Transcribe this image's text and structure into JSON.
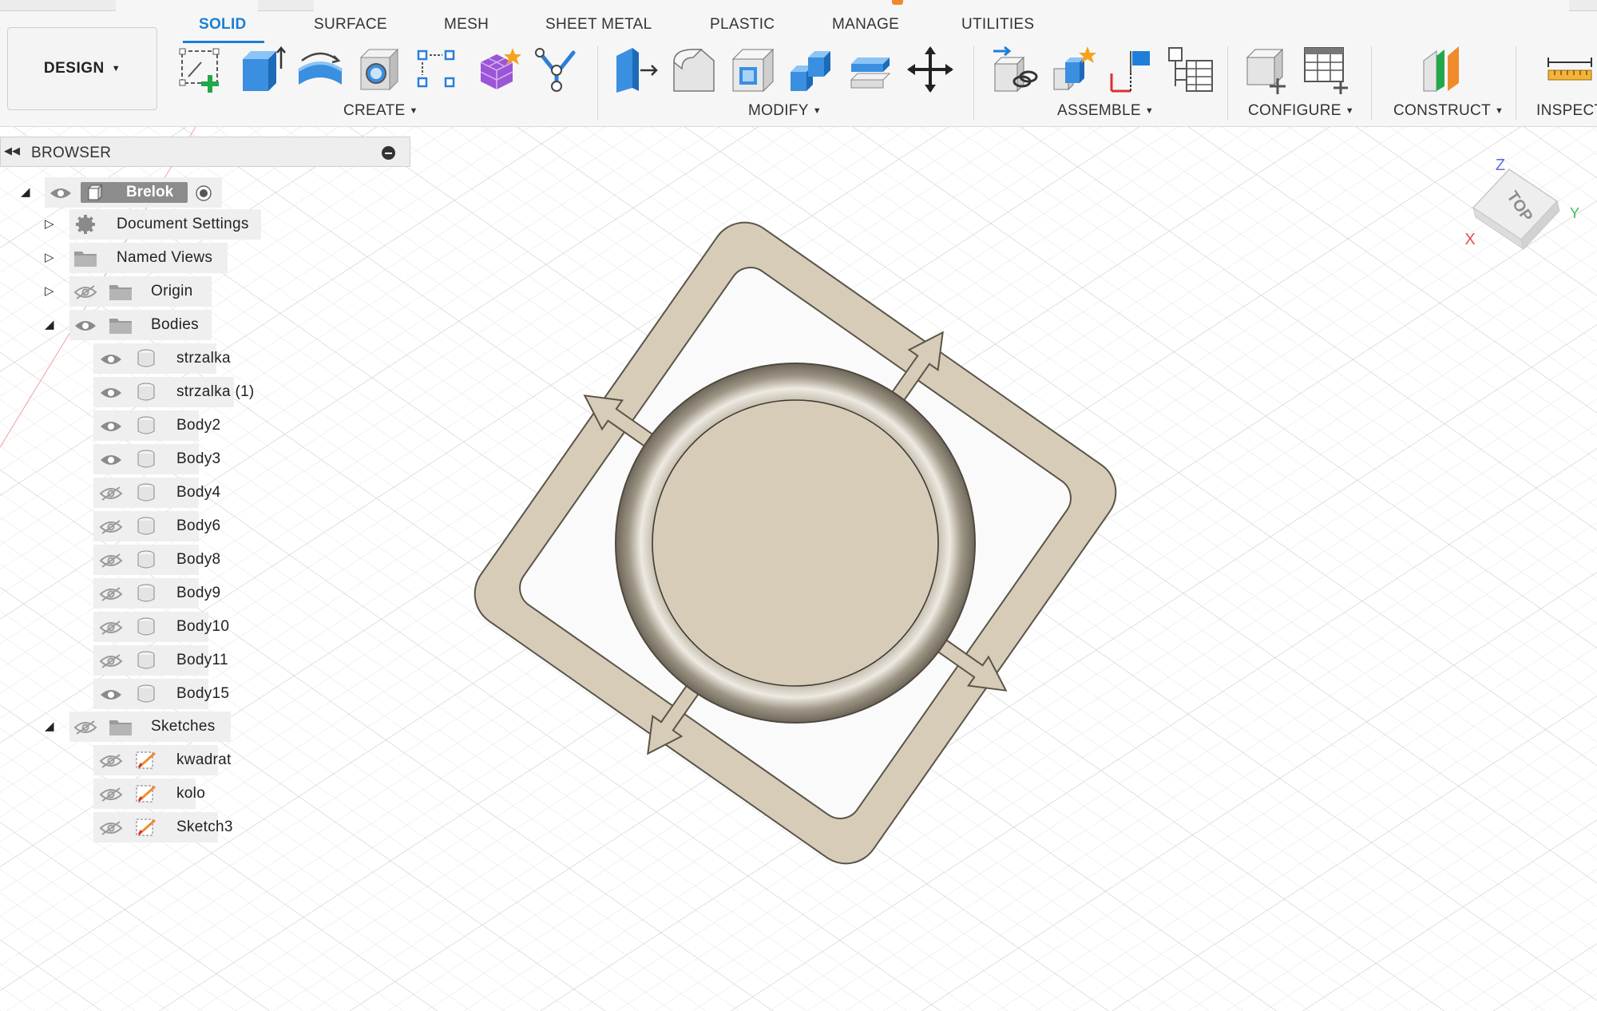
{
  "toolbar": {
    "workspace_label": "DESIGN",
    "tabs": [
      {
        "label": "SOLID",
        "active": true
      },
      {
        "label": "SURFACE"
      },
      {
        "label": "MESH"
      },
      {
        "label": "SHEET METAL"
      },
      {
        "label": "PLASTIC"
      },
      {
        "label": "MANAGE"
      },
      {
        "label": "UTILITIES"
      }
    ],
    "groups": [
      {
        "label": "CREATE",
        "tools": [
          "create-sketch-icon",
          "extrude-icon",
          "revolve-icon",
          "hole-icon",
          "pattern-icon",
          "form-icon",
          "derive-icon"
        ]
      },
      {
        "label": "MODIFY",
        "tools": [
          "press-pull-icon",
          "fillet-icon",
          "shell-icon",
          "combine-icon",
          "offset-face-icon",
          "move-icon"
        ]
      },
      {
        "label": "ASSEMBLE",
        "tools": [
          "new-component-icon",
          "joint-icon",
          "joint-origin-icon",
          "as-built-joint-icon"
        ]
      },
      {
        "label": "CONFIGURE",
        "tools": [
          "change-parameters-icon",
          "configuration-table-icon"
        ]
      },
      {
        "label": "CONSTRUCT",
        "tools": [
          "offset-plane-icon"
        ]
      },
      {
        "label": "INSPECT",
        "tools": [
          "measure-icon"
        ]
      }
    ],
    "accent_color": "#1a7fd6"
  },
  "browser": {
    "title": "BROWSER",
    "root": {
      "label": "Brelok"
    },
    "items": [
      {
        "label": "Document Settings",
        "icon": "gear-icon"
      },
      {
        "label": "Named Views",
        "icon": "folder-icon"
      },
      {
        "label": "Origin",
        "icon": "folder-icon",
        "visible": false
      },
      {
        "label": "Bodies",
        "icon": "folder-icon",
        "visible": true
      }
    ],
    "bodies": [
      {
        "label": "strzalka",
        "visible": true
      },
      {
        "label": "strzalka (1)",
        "visible": true
      },
      {
        "label": "Body2",
        "visible": true
      },
      {
        "label": "Body3",
        "visible": true
      },
      {
        "label": "Body4",
        "visible": false
      },
      {
        "label": "Body6",
        "visible": false
      },
      {
        "label": "Body8",
        "visible": false
      },
      {
        "label": "Body9",
        "visible": false
      },
      {
        "label": "Body10",
        "visible": false
      },
      {
        "label": "Body11",
        "visible": false
      },
      {
        "label": "Body15",
        "visible": true
      }
    ],
    "sketches_folder": {
      "label": "Sketches",
      "visible": false
    },
    "sketches": [
      {
        "label": "kwadrat",
        "visible": false
      },
      {
        "label": "kolo",
        "visible": false
      },
      {
        "label": "Sketch3",
        "visible": false
      }
    ]
  },
  "viewcube": {
    "face": "TOP",
    "axis_x": "X",
    "axis_y": "Y",
    "axis_z": "Z"
  },
  "colors": {
    "body": "#d6ccb8",
    "body_edge": "#5a5448",
    "grid": "#dcdcdc"
  }
}
